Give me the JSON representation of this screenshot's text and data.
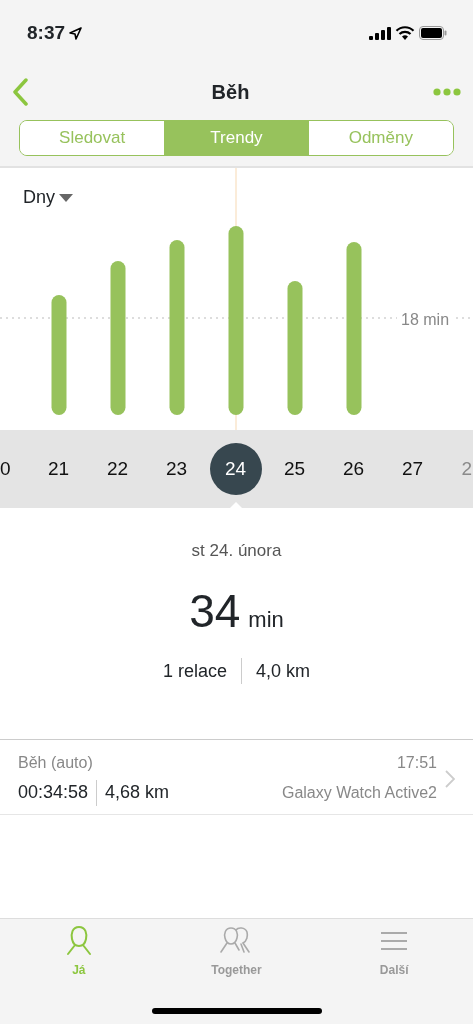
{
  "status_bar": {
    "time": "8:37"
  },
  "nav": {
    "title": "Běh"
  },
  "tabs": [
    {
      "label": "Sledovat",
      "selected": false
    },
    {
      "label": "Trendy",
      "selected": true
    },
    {
      "label": "Odměny",
      "selected": false
    }
  ],
  "period": {
    "label": "Dny"
  },
  "chart": {
    "reference_label": "18 min"
  },
  "days": [
    {
      "label": "0",
      "selected": false,
      "faded": false
    },
    {
      "label": "21",
      "selected": false,
      "faded": false
    },
    {
      "label": "22",
      "selected": false,
      "faded": false
    },
    {
      "label": "23",
      "selected": false,
      "faded": false
    },
    {
      "label": "24",
      "selected": true,
      "faded": false
    },
    {
      "label": "25",
      "selected": false,
      "faded": false
    },
    {
      "label": "26",
      "selected": false,
      "faded": false
    },
    {
      "label": "27",
      "selected": false,
      "faded": false
    },
    {
      "label": "2",
      "selected": false,
      "faded": true
    }
  ],
  "summary": {
    "date": "st 24. února",
    "value": "34",
    "unit": "min",
    "sessions": "1 relace",
    "distance": "4,0 km"
  },
  "records": [
    {
      "title": "Běh (auto)",
      "time": "17:51",
      "duration": "00:34:58",
      "distance": "4,68 km",
      "device": "Galaxy Watch Active2"
    }
  ],
  "bottom_tabs": [
    {
      "label": "Já",
      "kind": "person",
      "selected": true
    },
    {
      "label": "Together",
      "kind": "people",
      "selected": false
    },
    {
      "label": "Další",
      "kind": "menu",
      "selected": false
    }
  ]
}
